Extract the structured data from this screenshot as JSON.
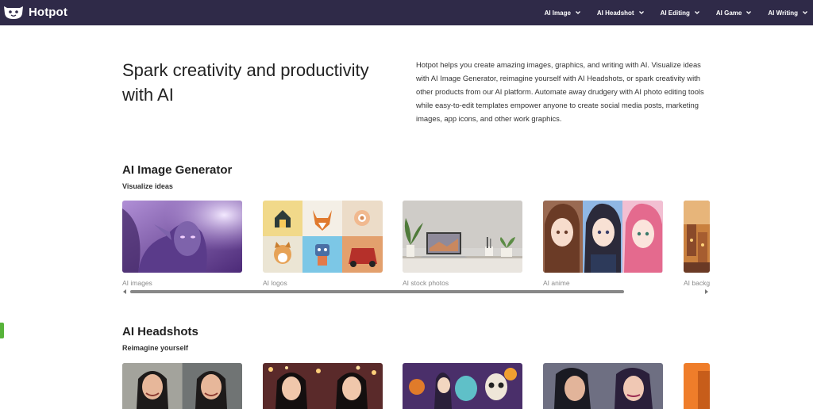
{
  "brand": {
    "name": "Hotpot"
  },
  "nav": {
    "items": [
      {
        "label": "AI Image"
      },
      {
        "label": "AI Headshot"
      },
      {
        "label": "AI Editing"
      },
      {
        "label": "AI Game"
      },
      {
        "label": "AI Writing"
      }
    ]
  },
  "hero": {
    "title": "Spark creativity and productivity with AI",
    "description": "Hotpot helps you create amazing images, graphics, and writing with AI. Visualize ideas with AI Image Generator, reimagine yourself with AI Headshots, or spark creativity with other products from our AI platform. Automate away drudgery with AI photo editing tools while easy-to-edit templates empower anyone to create social media posts, marketing images, app icons, and other work graphics."
  },
  "sections": [
    {
      "title": "AI Image Generator",
      "subtitle": "Visualize ideas",
      "cards": [
        {
          "label": "AI images"
        },
        {
          "label": "AI logos"
        },
        {
          "label": "AI stock photos"
        },
        {
          "label": "AI anime"
        },
        {
          "label": "AI backg"
        }
      ]
    },
    {
      "title": "AI Headshots",
      "subtitle": "Reimagine yourself"
    }
  ],
  "colors": {
    "topbar": "#2f2a48",
    "accent_tab": "#57b33a"
  }
}
